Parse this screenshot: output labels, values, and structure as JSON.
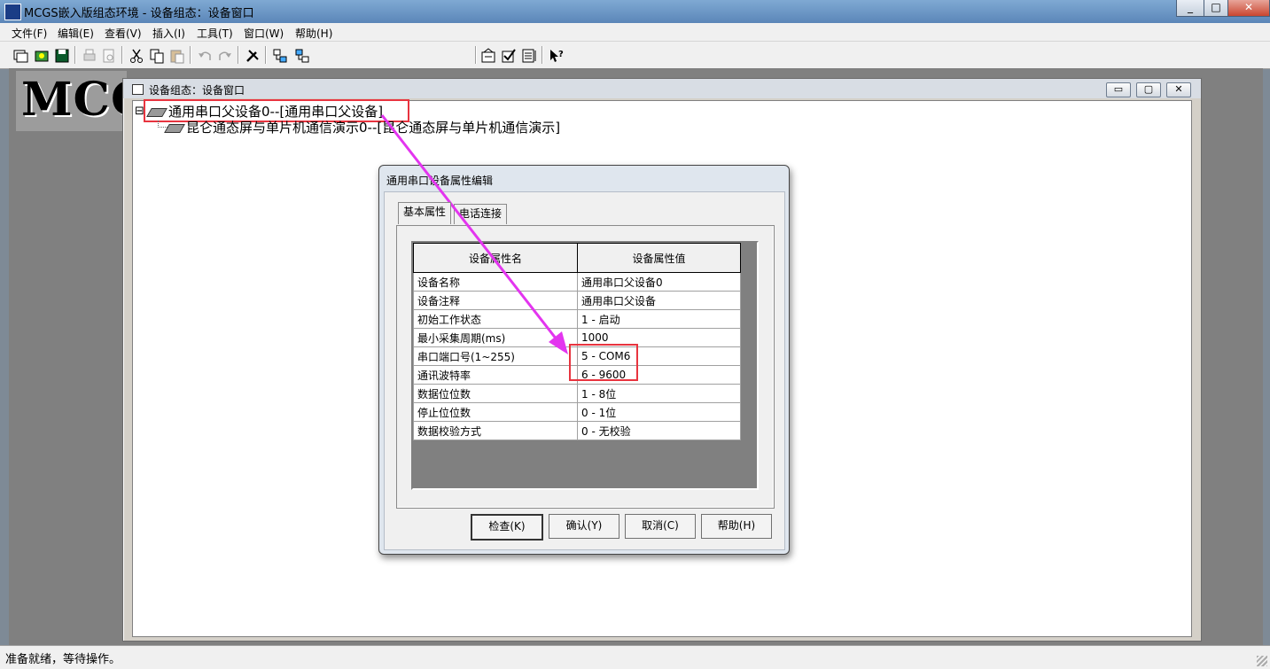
{
  "app": {
    "title": "MCGS嵌入版组态环境 - 设备组态：设备窗口",
    "caption_buttons": [
      "_",
      "□",
      "✕"
    ]
  },
  "menu": [
    "文件(F)",
    "编辑(E)",
    "查看(V)",
    "插入(I)",
    "工具(T)",
    "窗口(W)",
    "帮助(H)"
  ],
  "toolbar": {
    "icons": [
      "new-window-icon",
      "open-icon",
      "save-icon",
      "print-icon",
      "print-preview-icon",
      "cut-icon",
      "copy-icon",
      "paste-icon",
      "undo-icon",
      "redo-icon",
      "tools-icon",
      "device-tree-icon",
      "device-tree2-icon",
      "properties-icon",
      "check-icon",
      "list-icon",
      "help-icon"
    ]
  },
  "logo": {
    "text": "MCG"
  },
  "child_window": {
    "title": "设备组态：设备窗口",
    "buttons": [
      "▭",
      "▢",
      "✕"
    ],
    "tree": [
      {
        "expander": "⊟",
        "label": "通用串口父设备0--[通用串口父设备]"
      },
      {
        "label": "昆仑通态屏与单片机通信演示0--[昆仑通态屏与单片机通信演示]"
      }
    ]
  },
  "dialog": {
    "title": "通用串口设备属性编辑",
    "tabs": [
      "基本属性",
      "电话连接"
    ],
    "columns": [
      "设备属性名",
      "设备属性值"
    ],
    "rows": [
      [
        "设备名称",
        "通用串口父设备0"
      ],
      [
        "设备注释",
        "通用串口父设备"
      ],
      [
        "初始工作状态",
        "1 - 启动"
      ],
      [
        "最小采集周期(ms)",
        "1000"
      ],
      [
        "串口端口号(1~255)",
        "5 - COM6"
      ],
      [
        "通讯波特率",
        "6 - 9600"
      ],
      [
        "数据位位数",
        "1 - 8位"
      ],
      [
        "停止位位数",
        "0 - 1位"
      ],
      [
        "数据校验方式",
        "0 - 无校验"
      ]
    ],
    "buttons": [
      "检查(K)",
      "确认(Y)",
      "取消(C)",
      "帮助(H)"
    ]
  },
  "status": "准备就绪，等待操作。",
  "colors": {
    "highlight": "#e8343f",
    "arrow": "#e335ef"
  }
}
